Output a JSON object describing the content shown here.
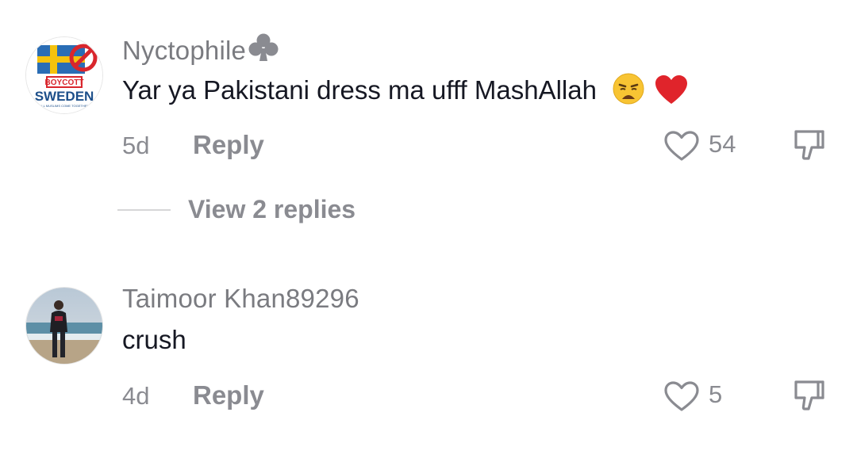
{
  "comments": [
    {
      "username": "Nyctophile",
      "username_suffix_icon": "club-suit-icon",
      "text": "Yar ya Pakistani dress ma ufff MashAllah",
      "emojis": [
        "weary-face-emoji",
        "red-heart-emoji"
      ],
      "time": "5d",
      "reply_label": "Reply",
      "like_count": "54",
      "avatar": {
        "badge_top": "BOYCOTT",
        "badge_bottom": "SWEDEN",
        "badge_small": "ALL MUSLIMS COME TOGETHER"
      },
      "view_replies_label": "View 2 replies"
    },
    {
      "username": "Taimoor Khan89296",
      "text": "crush",
      "time": "4d",
      "reply_label": "Reply",
      "like_count": "5"
    }
  ],
  "colors": {
    "secondary_text": "#8a8b91",
    "primary_text": "#161823",
    "heart_red": "#e0242b"
  }
}
